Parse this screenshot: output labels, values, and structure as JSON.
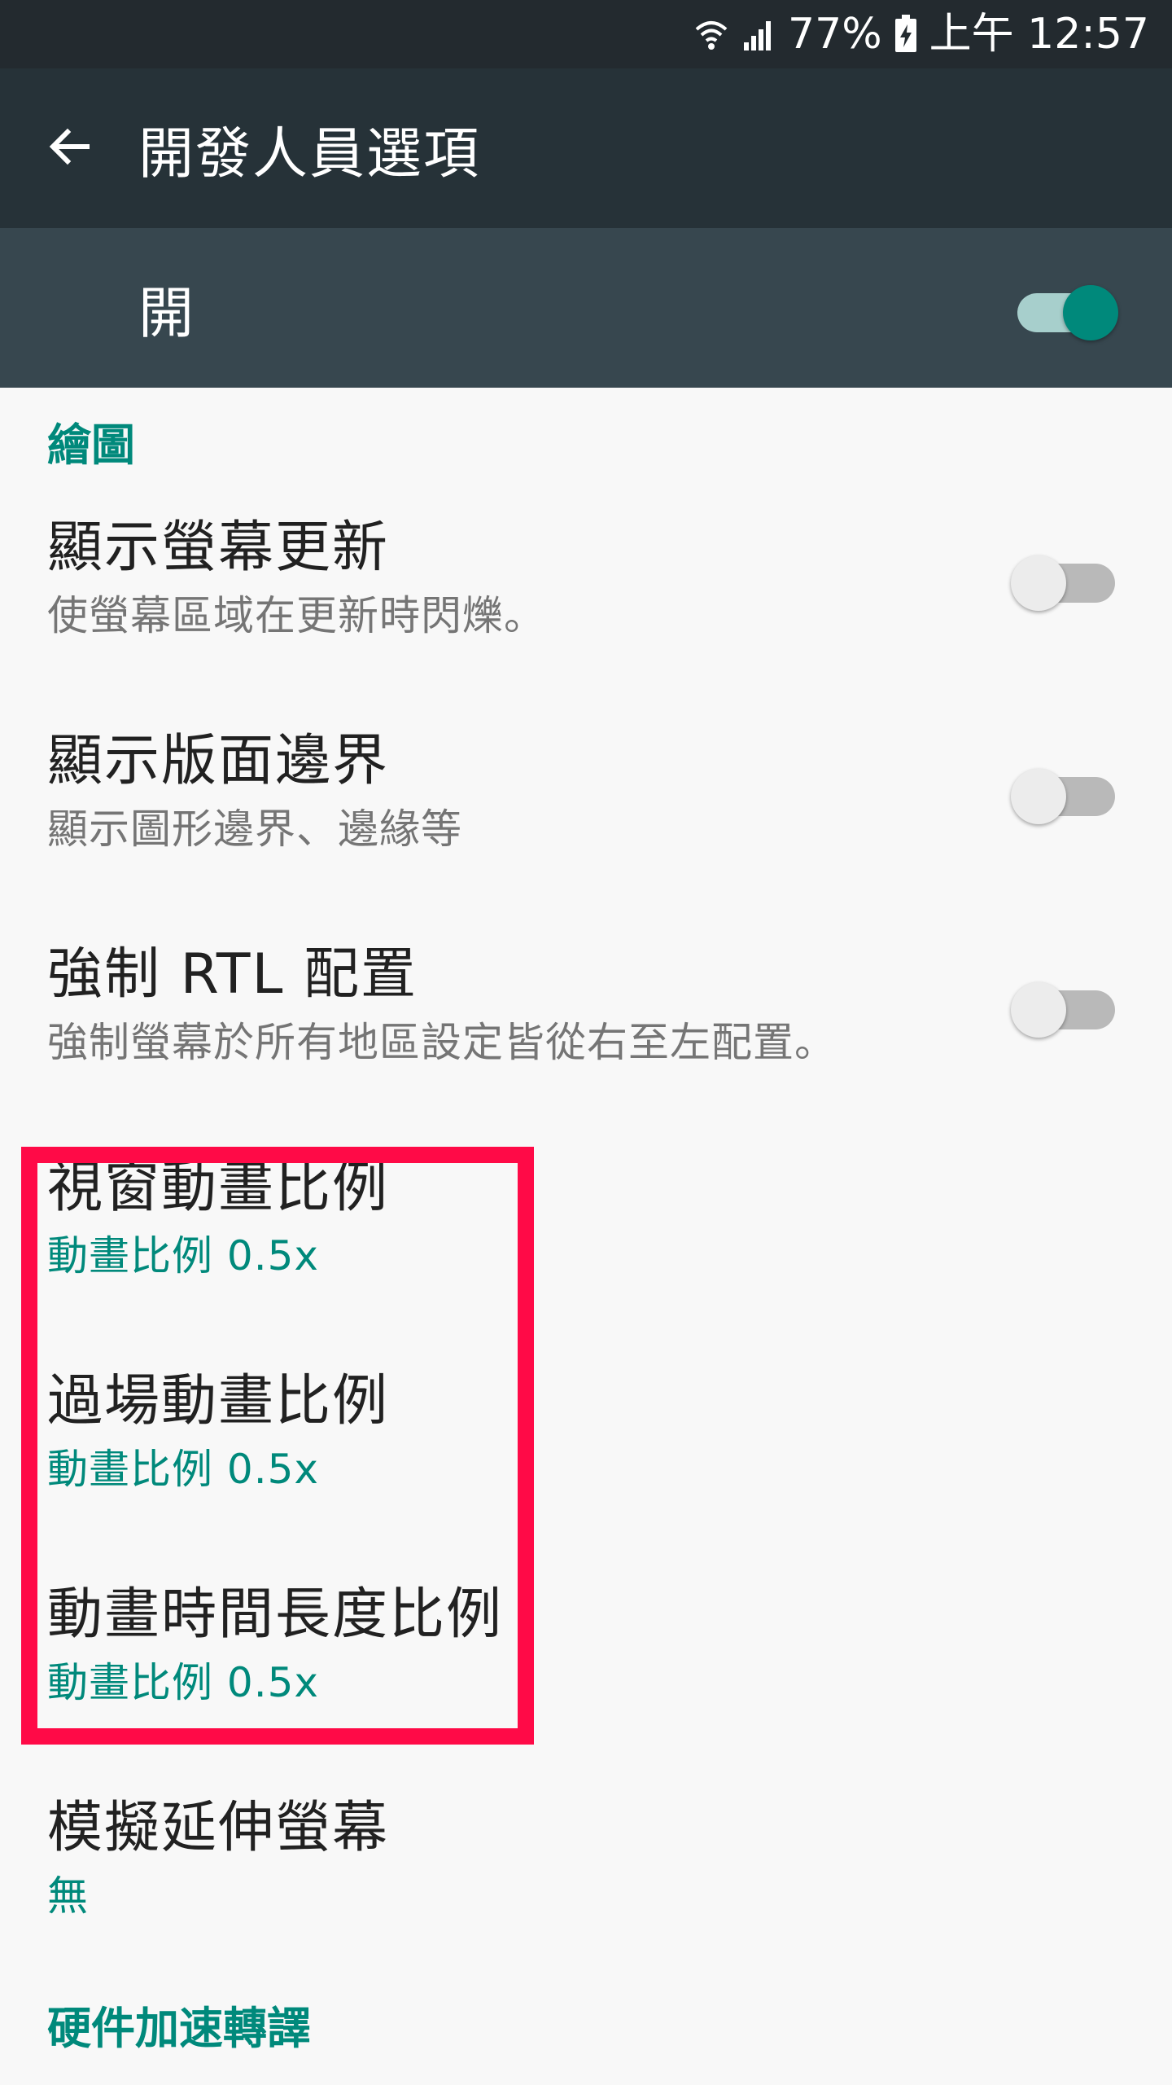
{
  "status_bar": {
    "battery_percent": "77%",
    "time": "上午 12:57",
    "icons": [
      "wifi-icon",
      "signal-icon",
      "battery-charging-icon"
    ]
  },
  "toolbar": {
    "title": "開發人員選項",
    "back_icon": "arrow-back-icon"
  },
  "master_switch": {
    "label": "開",
    "on": true
  },
  "sections": [
    {
      "header": "繪圖"
    },
    {
      "header": "硬件加速轉譯"
    }
  ],
  "prefs": [
    {
      "title": "顯示螢幕更新",
      "summary": "使螢幕區域在更新時閃爍。",
      "toggle": false
    },
    {
      "title": "顯示版面邊界",
      "summary": "顯示圖形邊界、邊緣等",
      "toggle": false
    },
    {
      "title": "強制 RTL 配置",
      "summary": "強制螢幕於所有地區設定皆從右至左配置。",
      "toggle": false
    },
    {
      "title": "視窗動畫比例",
      "summary": "動畫比例 0.5x"
    },
    {
      "title": "過場動畫比例",
      "summary": "動畫比例 0.5x"
    },
    {
      "title": "動畫時間長度比例",
      "summary": "動畫比例 0.5x"
    },
    {
      "title": "模擬延伸螢幕",
      "summary": "無"
    }
  ],
  "colors": {
    "accent": "#00897b",
    "highlight": "#ff0a47",
    "toolbar": "#263238",
    "master_bar": "#37474f",
    "status_bar": "#232a2f"
  }
}
